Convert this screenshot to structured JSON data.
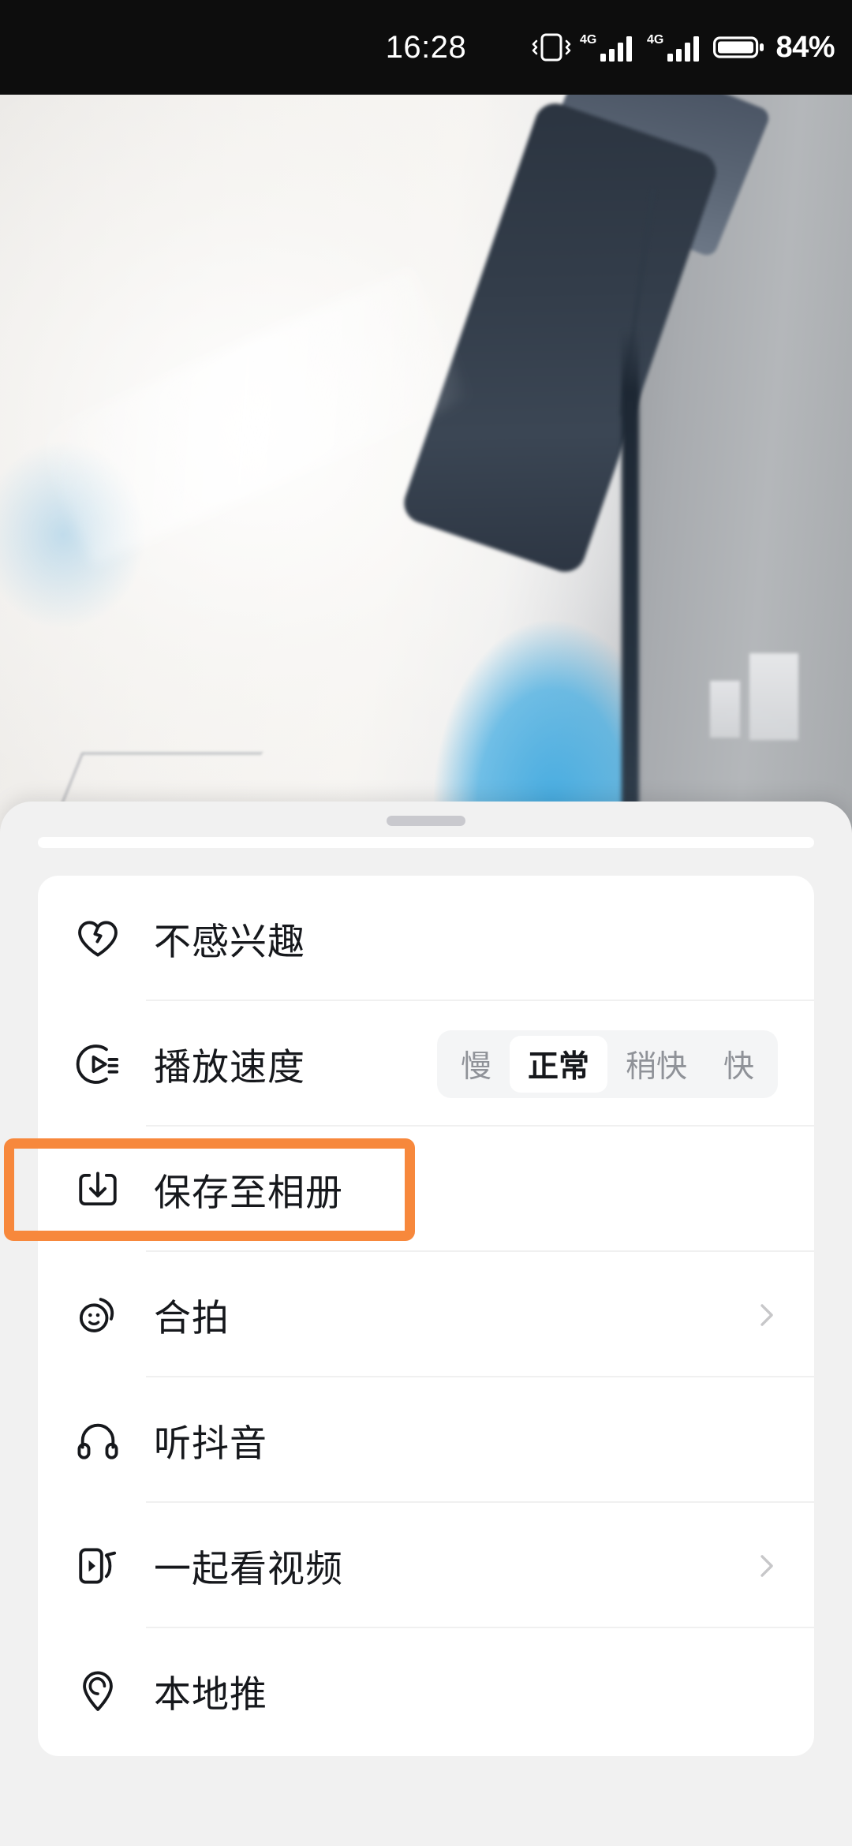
{
  "status_bar": {
    "time": "16:28",
    "battery_percent": "84%",
    "icons": [
      "vibrate-icon",
      "signal-4g-sim1-icon",
      "signal-4g-sim2-icon",
      "battery-icon"
    ],
    "network_label_1": "4G",
    "network_label_2": "4G",
    "background_color": "#0d0d0d"
  },
  "sheet": {
    "handle": "drag-handle",
    "background_color": "#f1f1f1",
    "card_background": "#ffffff"
  },
  "menu": {
    "items": [
      {
        "id": "not-interested",
        "icon": "broken-heart-icon",
        "label": "不感兴趣",
        "has_chevron": false,
        "has_segmented": false
      },
      {
        "id": "playback-speed",
        "icon": "play-speed-icon",
        "label": "播放速度",
        "has_chevron": false,
        "has_segmented": true
      },
      {
        "id": "save-to-album",
        "icon": "download-icon",
        "label": "保存至相册",
        "has_chevron": false,
        "has_segmented": false,
        "highlighted": true
      },
      {
        "id": "duet",
        "icon": "duet-face-icon",
        "label": "合拍",
        "has_chevron": true,
        "has_segmented": false
      },
      {
        "id": "listen-douyin",
        "icon": "headphones-icon",
        "label": "听抖音",
        "has_chevron": false,
        "has_segmented": false
      },
      {
        "id": "watch-together",
        "icon": "watch-together-icon",
        "label": "一起看视频",
        "has_chevron": true,
        "has_segmented": false
      },
      {
        "id": "local-promotion",
        "icon": "location-pin-icon",
        "label": "本地推",
        "has_chevron": false,
        "has_segmented": false
      }
    ]
  },
  "speed_control": {
    "options": [
      "慢",
      "正常",
      "稍快",
      "快"
    ],
    "selected": "正常",
    "track_color": "#f4f5f6",
    "pill_color": "#ffffff",
    "inactive_text_color": "#8f9298",
    "active_text_color": "#16181c"
  },
  "highlight": {
    "target": "save-to-album",
    "color": "#f7883c",
    "border_width_px": 13
  }
}
